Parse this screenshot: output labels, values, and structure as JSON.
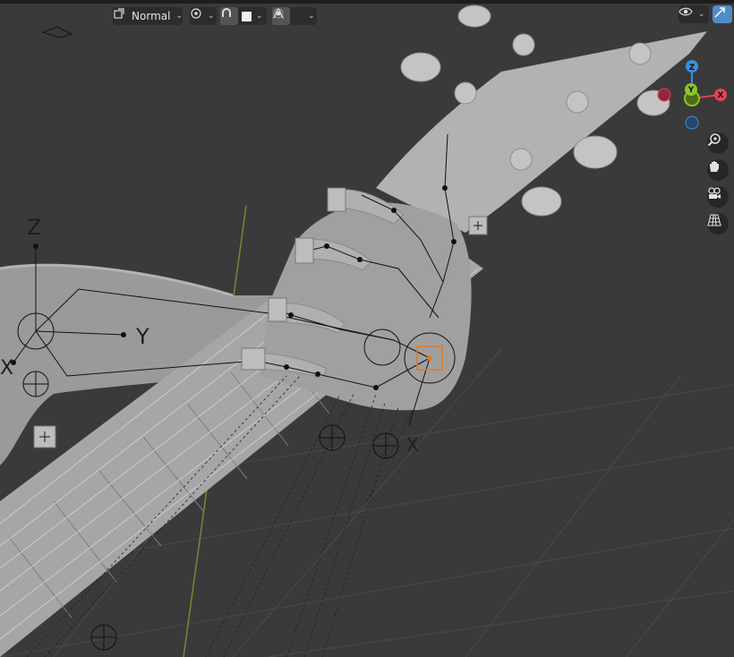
{
  "toolbar": {
    "transform_orientation_icon": "transform-orientation-icon",
    "orientation_label": "Normal",
    "pivot_icon": "pivot-point-icon",
    "snap_icon": "snap-magnet-icon",
    "snap_color": "#f2f2f2",
    "proportional_icon": "proportional-edit-icon",
    "falloff_icon": "falloff-curve-icon"
  },
  "overlays": {
    "visibility_icon": "eye-icon",
    "gizmo_toggle_icon": "viewport-gizmo-icon",
    "accent": "#4f8cc9"
  },
  "navigation_gizmo": {
    "z_label": "Z",
    "y_label": "Y",
    "x_label": "X",
    "x_color": "#e5405b",
    "y_color": "#8cc424",
    "z_color": "#3d8ee0"
  },
  "nav_buttons": [
    "zoom-icon",
    "pan-hand-icon",
    "camera-icon",
    "perspective-grid-icon"
  ],
  "scene": {
    "empty_axis_z": "Z",
    "empty_axis_y": "Y",
    "empty_axis_x": "X",
    "hand_axis_x": "X",
    "selected_color": "#e57a1f"
  }
}
